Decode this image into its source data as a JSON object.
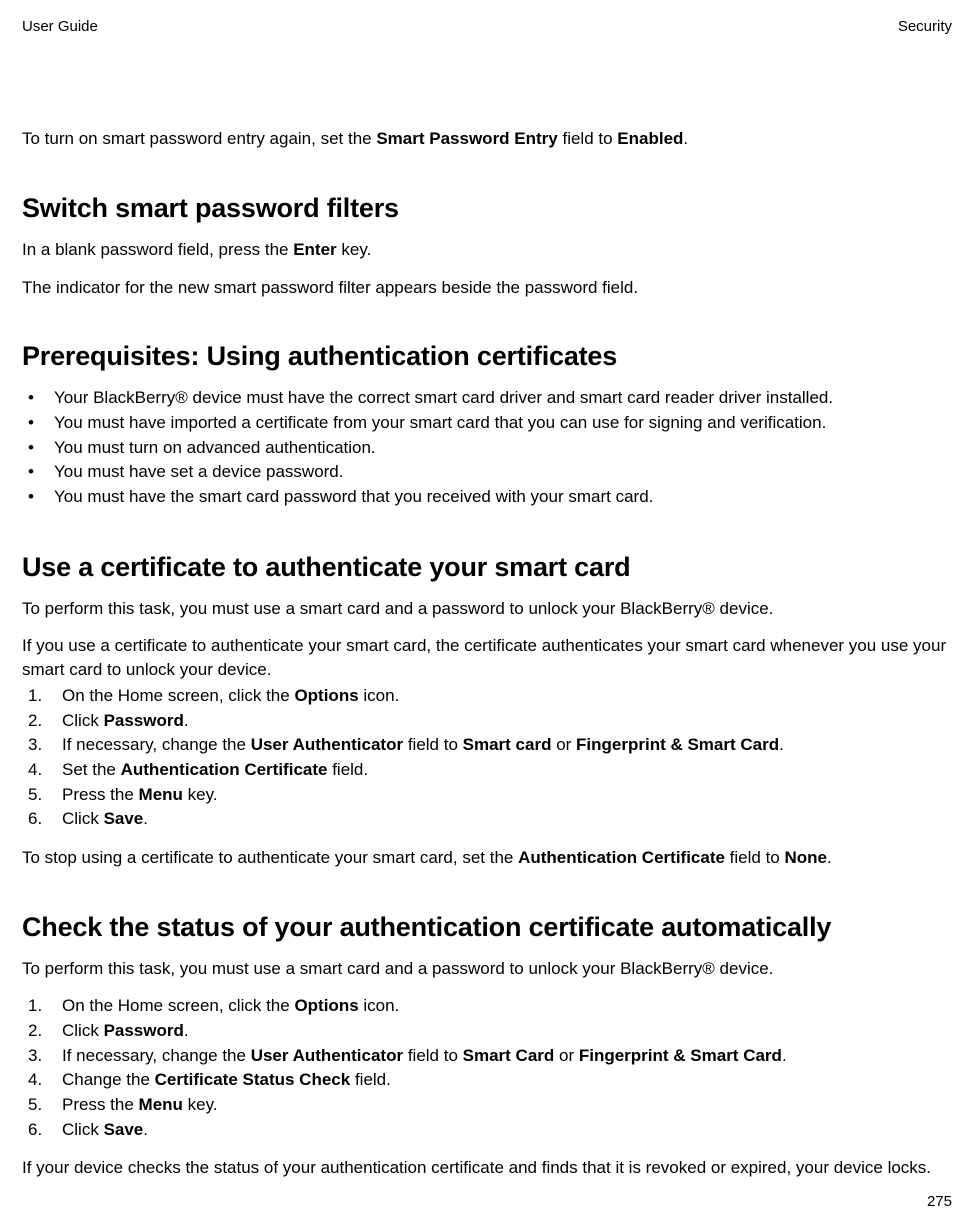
{
  "header": {
    "left": "User Guide",
    "right": "Security"
  },
  "intro": {
    "runs": [
      "To turn on smart password entry again, set the ",
      "Smart Password Entry",
      " field to ",
      "Enabled",
      "."
    ]
  },
  "section1": {
    "heading": "Switch smart password filters",
    "p1": {
      "runs": [
        "In a blank password field, press the ",
        "Enter",
        " key."
      ]
    },
    "p2": "The indicator for the new smart password filter appears beside the password field."
  },
  "section2": {
    "heading": "Prerequisites: Using authentication certificates",
    "bullets": [
      "Your BlackBerry® device must have the correct smart card driver and smart card reader driver installed.",
      "You must have imported a certificate from your smart card that you can use for signing and verification.",
      "You must turn on advanced authentication.",
      "You must have set a device password.",
      "You must have the smart card password that you received with your smart card."
    ]
  },
  "section3": {
    "heading": "Use a certificate to authenticate your smart card",
    "p1": "To perform this task, you must use a smart card and a password to unlock your BlackBerry® device.",
    "p2": "If you use a certificate to authenticate your smart card, the certificate authenticates your smart card whenever you use your smart card to unlock your device.",
    "steps": [
      {
        "runs": [
          "On the Home screen, click the ",
          "Options",
          " icon."
        ]
      },
      {
        "runs": [
          "Click ",
          "Password",
          "."
        ]
      },
      {
        "runs": [
          "If necessary, change the ",
          "User Authenticator",
          " field to ",
          "Smart card",
          " or ",
          "Fingerprint & Smart Card",
          "."
        ]
      },
      {
        "runs": [
          "Set the ",
          "Authentication Certificate",
          " field."
        ]
      },
      {
        "runs": [
          "Press the ",
          "Menu",
          " key."
        ]
      },
      {
        "runs": [
          "Click ",
          "Save",
          "."
        ]
      }
    ],
    "p3": {
      "runs": [
        "To stop using a certificate to authenticate your smart card, set the ",
        "Authentication Certificate",
        " field to ",
        "None",
        "."
      ]
    }
  },
  "section4": {
    "heading": "Check the status of your authentication certificate automatically",
    "p1": "To perform this task, you must use a smart card and a password to unlock your BlackBerry® device.",
    "steps": [
      {
        "runs": [
          "On the Home screen, click the ",
          "Options",
          " icon."
        ]
      },
      {
        "runs": [
          "Click ",
          "Password",
          "."
        ]
      },
      {
        "runs": [
          "If necessary, change the ",
          "User Authenticator",
          " field to ",
          "Smart Card",
          " or ",
          "Fingerprint & Smart Card",
          "."
        ]
      },
      {
        "runs": [
          "Change the ",
          "Certificate Status Check",
          " field."
        ]
      },
      {
        "runs": [
          "Press the ",
          "Menu",
          " key."
        ]
      },
      {
        "runs": [
          "Click ",
          "Save",
          "."
        ]
      }
    ],
    "p2": "If your device checks the status of your authentication certificate and finds that it is revoked or expired, your device locks."
  },
  "pageNumber": "275"
}
